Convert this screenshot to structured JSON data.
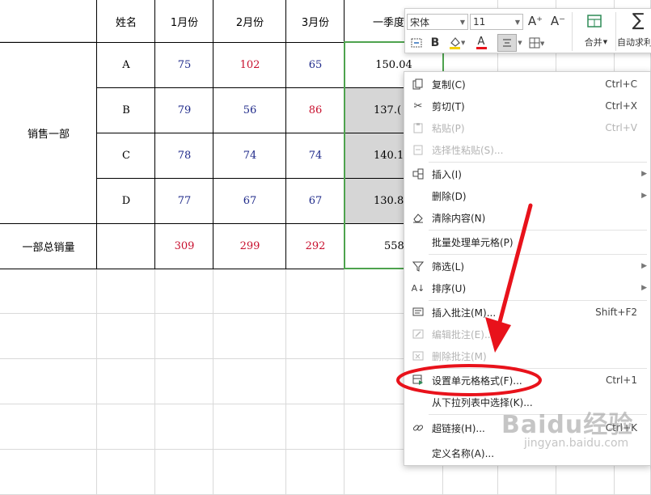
{
  "table": {
    "headers": [
      "姓名",
      "1月份",
      "2月份",
      "3月份",
      "一季度纟"
    ],
    "department": "销售一部",
    "rows": [
      {
        "name": "A",
        "jan": "75",
        "feb": "102",
        "mar": "65",
        "q1": "150.04"
      },
      {
        "name": "B",
        "jan": "79",
        "feb": "56",
        "mar": "86",
        "q1": "137.("
      },
      {
        "name": "C",
        "jan": "78",
        "feb": "74",
        "mar": "74",
        "q1": "140.1"
      },
      {
        "name": "D",
        "jan": "77",
        "feb": "67",
        "mar": "67",
        "q1": "130.8"
      }
    ],
    "total": {
      "label": "一部总销量",
      "jan": "309",
      "feb": "299",
      "mar": "292",
      "q1": "558"
    }
  },
  "mini_toolbar": {
    "font_name": "宋体",
    "font_size": "11",
    "grow_font": "A⁺",
    "shrink_font": "A⁻",
    "bold": "B",
    "font_color": "A",
    "merge_label": "合并",
    "autosum_label": "自动求利"
  },
  "context_menu": {
    "items": [
      {
        "label": "复制(C)",
        "shortcut": "Ctrl+C",
        "icon": "copy-icon"
      },
      {
        "label": "剪切(T)",
        "shortcut": "Ctrl+X",
        "icon": "scissors-icon"
      },
      {
        "label": "粘贴(P)",
        "shortcut": "Ctrl+V",
        "icon": "paste-icon",
        "disabled": true
      },
      {
        "label": "选择性粘贴(S)...",
        "shortcut": "",
        "icon": "paste-special-icon",
        "disabled": true
      },
      {
        "label": "插入(I)",
        "shortcut": "",
        "icon": "insert-icon",
        "submenu": true
      },
      {
        "label": "删除(D)",
        "shortcut": "",
        "icon": "",
        "submenu": true
      },
      {
        "label": "清除内容(N)",
        "shortcut": "",
        "icon": "eraser-icon"
      },
      {
        "label": "批量处理单元格(P)",
        "shortcut": "",
        "icon": ""
      },
      {
        "label": "筛选(L)",
        "shortcut": "",
        "icon": "filter-icon",
        "submenu": true
      },
      {
        "label": "排序(U)",
        "shortcut": "",
        "icon": "sort-icon",
        "submenu": true
      },
      {
        "label": "插入批注(M)...",
        "shortcut": "Shift+F2",
        "icon": "comment-icon"
      },
      {
        "label": "编辑批注(E)...",
        "shortcut": "",
        "icon": "edit-comment-icon",
        "disabled": true
      },
      {
        "label": "删除批注(M)",
        "shortcut": "",
        "icon": "delete-comment-icon",
        "disabled": true
      },
      {
        "label": "设置单元格格式(F)...",
        "shortcut": "Ctrl+1",
        "icon": "format-cells-icon"
      },
      {
        "label": "从下拉列表中选择(K)...",
        "shortcut": "",
        "icon": ""
      },
      {
        "label": "超链接(H)...",
        "shortcut": "Ctrl+K",
        "icon": "link-icon"
      },
      {
        "label": "定义名称(A)...",
        "shortcut": "",
        "icon": ""
      }
    ]
  },
  "watermark": {
    "brand": "Baidu经验",
    "url": "jingyan.baidu.com"
  },
  "colors": {
    "annotation": "#e8121b",
    "selection_border": "#4ea34e",
    "value_blue": "#1f2a8a",
    "value_red": "#c8102e"
  }
}
